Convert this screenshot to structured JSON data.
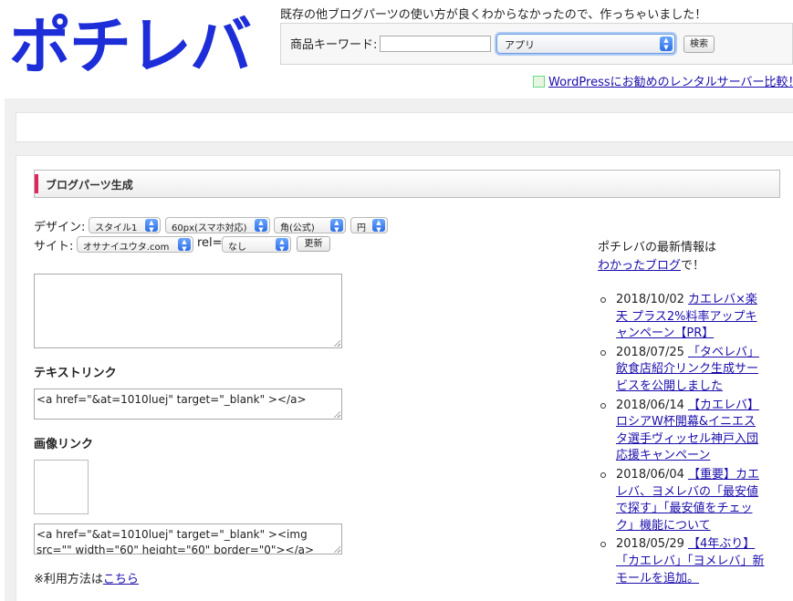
{
  "header": {
    "logo_text": "ポチレバ",
    "tagline": "既存の他ブログパーツの使い方が良くわからなかったので、作っちゃいました！",
    "search": {
      "label": "商品キーワード:",
      "input_value": "",
      "category_selected": "アプリ",
      "button_label": "検索"
    },
    "wp_link": "WordPressにお勧めのレンタルサーバー比較！"
  },
  "main": {
    "section_title": "ブログパーツ生成",
    "design_label": "デザイン:",
    "design_style": "スタイル1",
    "design_size": "60px(スマホ対応)",
    "design_corner": "角(公式)",
    "design_currency": "円",
    "site_label": "サイト:",
    "site_value": "オサナイユウタ.com",
    "rel_label": "rel=",
    "rel_value": "なし",
    "update_button": "更新",
    "blog_textarea": "",
    "text_link_heading": "テキストリンク",
    "text_link_code": "<a href=\"&at=1010luej\" target=\"_blank\" ></a>",
    "image_link_heading": "画像リンク",
    "image_link_code": "<a href=\"&at=1010luej\" target=\"_blank\" ><img src=\"\" width=\"60\" height=\"60\" border=\"0\"></a>",
    "note_prefix": "※利用方法は",
    "note_link": "こちら"
  },
  "sidebar": {
    "intro_line1": "ポチレバの最新情報は",
    "intro_link": "わかったブログ",
    "intro_suffix": "で！",
    "news": [
      {
        "date": "2018/10/02",
        "title": "カエレバ×楽天 プラス2%料率アップキャンペーン【PR】"
      },
      {
        "date": "2018/07/25",
        "title": "「タベレバ」飲食店紹介リンク生成サービスを公開しました"
      },
      {
        "date": "2018/06/14",
        "title": "【カエレバ】ロシアW杯開幕&イニエスタ選手ヴィッセル神戸入団応援キャンペーン"
      },
      {
        "date": "2018/06/04",
        "title": "【重要】カエレバ、ヨメレバの「最安値で探す」「最安値をチェック」機能について"
      },
      {
        "date": "2018/05/29",
        "title": "【4年ぶり】「カエレバ」「ヨメレバ」新モールを追加。"
      }
    ]
  },
  "colors": {
    "logo_blue": "#1d2ed8",
    "accent_pink": "#e0245e",
    "link": "#1a0dab"
  }
}
